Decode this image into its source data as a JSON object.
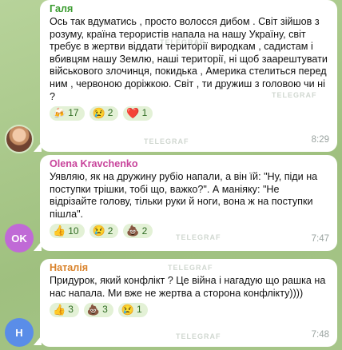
{
  "messages": [
    {
      "author": "Галя",
      "author_color": "#3a9b2f",
      "text": "Ось так вдуматись , просто волосся дибом . Світ зійшов з розуму, країна терористів напала на нашу Україну, світ требує в жертви віддати території виродкам , садистам і вбивцям нашу Землю, наші території, ні щоб заарештувати військового злочинця, покидька , Америка стелиться перед ним , червоною доріжкою. Світ , ти дружиш з головою чи ні ?",
      "reactions": [
        {
          "emoji": "🍻",
          "count": "17"
        },
        {
          "emoji": "😢",
          "count": "2"
        },
        {
          "emoji": "❤️",
          "count": "1"
        }
      ],
      "time": "8:29"
    },
    {
      "author": "Olena Kravchenko",
      "author_color": "#c8449b",
      "text": "Уявляю, як на дружину рубіо напали, а він їй: \"Ну, піди на поступки трішки, тобі що, важко?\". А маніяку: \"Не відрізайте голову, тільки руки й ноги, вона ж на поступки пішла\".",
      "reactions": [
        {
          "emoji": "👍",
          "count": "10"
        },
        {
          "emoji": "😢",
          "count": "2"
        },
        {
          "emoji": "💩",
          "count": "2"
        }
      ],
      "time": "7:47",
      "avatar_label": "OK",
      "avatar_color": "#c06ad6"
    },
    {
      "author": "Наталія",
      "author_color": "#d9822b",
      "text": "Придурок, який конфлікт ? Це війна і нагадую що рашка на нас напала. Ми вже не жертва а сторона конфлікту))))",
      "reactions": [
        {
          "emoji": "👍",
          "count": "3"
        },
        {
          "emoji": "💩",
          "count": "3"
        },
        {
          "emoji": "😢",
          "count": "1"
        }
      ],
      "time": "7:48",
      "avatar_label": "Н",
      "avatar_color": "#5a8de8"
    }
  ],
  "watermark": "TELEGRAF"
}
